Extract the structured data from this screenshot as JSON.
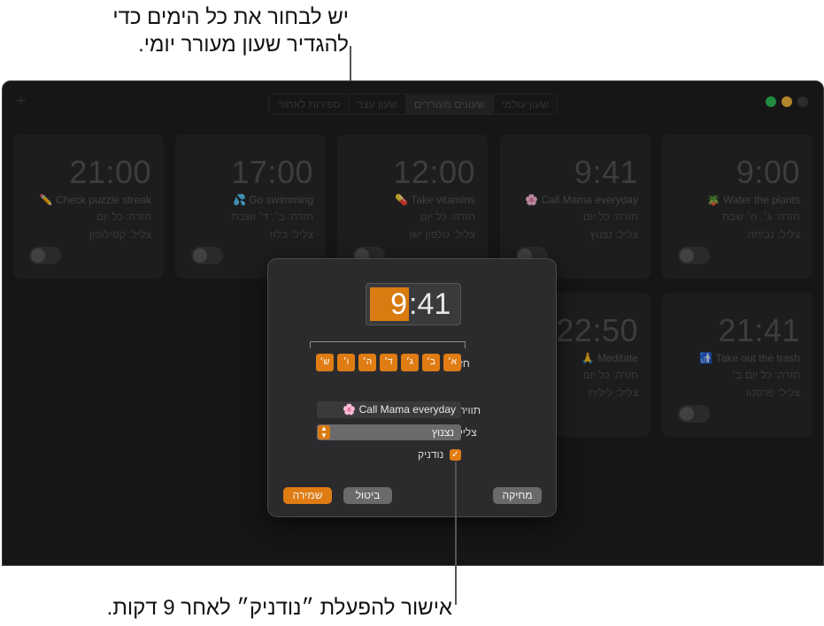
{
  "callouts": {
    "top_line1": "יש לבחור את כל הימים כדי",
    "top_line2": "להגדיר שעון מעורר יומי.",
    "bottom": "אישור להפעלת ״נודניק״ לאחר 9 דקות."
  },
  "toolbar": {
    "add_symbol": "+",
    "tabs": [
      {
        "label": "שעון עולמי"
      },
      {
        "label": "שעונים מעוררים"
      },
      {
        "label": "שעון עצר"
      },
      {
        "label": "ספירות לאחור"
      }
    ],
    "active_tab": "שעונים מעוררים"
  },
  "alarms": [
    {
      "time": "9:00",
      "label": "Water the plants 🪴",
      "repeat": "חזרה: ג׳, ה׳ שבת",
      "sound": "צליל: נביחה"
    },
    {
      "time": "9:41",
      "label": "Call Mama everyday 🌸",
      "repeat": "חזרה: כל יום",
      "sound": "צליל: נצנוץ"
    },
    {
      "time": "12:00",
      "label": "Take vitamins 💊",
      "repeat": "חזרה: כל יום",
      "sound": "צליל: טלפון ישן"
    },
    {
      "time": "17:00",
      "label": "Go swimming 💦",
      "repeat": "חזרה: ב׳, ד׳ ושבת",
      "sound": "צליל: בלוז"
    },
    {
      "time": "21:00",
      "label": "Check puzzle streak ✏️",
      "repeat": "חזרה: כל יום",
      "sound": "צליל: קסילופון"
    },
    {
      "time": "21:41",
      "label": "Take out the trash 🚮",
      "repeat": "חזרה: כל יום ב׳",
      "sound": "צליל: פרסטו"
    },
    {
      "time": "22:50",
      "label": "Meditate 🙏",
      "repeat": "חזרה: כל יום",
      "sound": "צליל: לילית"
    }
  ],
  "dialog": {
    "time_hour": "9",
    "time_rest": ":41",
    "repeat_label": "חזרה:",
    "days": [
      "א׳",
      "ב׳",
      "ג׳",
      "ד׳",
      "ה׳",
      "ו׳",
      "ש׳"
    ],
    "label_label": "תווית:",
    "label_value": "🌸 Call Mama everyday",
    "sound_label": "צליל:",
    "sound_value": "נצנוץ",
    "snooze_label": "נודניק",
    "snooze_checked": true,
    "save": "שמירה",
    "cancel": "ביטול",
    "delete": "מחיקה"
  },
  "colors": {
    "accent": "#e07c14",
    "window_bg": "#1f1f20",
    "card_bg": "#29292a",
    "dialog_bg": "#2b2b2d"
  }
}
